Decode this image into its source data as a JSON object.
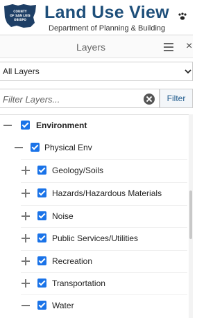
{
  "header": {
    "logo_text": "COUNTY OF SAN LUIS OBISPO",
    "title": "Land Use View",
    "subtitle": "Department of Planning & Building",
    "paw_icon": "paw-icon"
  },
  "panel": {
    "title": "Layers",
    "menu_icon": "list-icon",
    "close_glyph": "×"
  },
  "layer_select": {
    "value": "All Layers",
    "chevron": "chevron-down-icon"
  },
  "filter": {
    "placeholder": "Filter Layers...",
    "button_label": "Filter",
    "clear_icon": "clear-icon"
  },
  "colors": {
    "title_blue": "#1e4f7a",
    "checkbox_blue": "#1a73e8"
  },
  "tree": [
    {
      "label": "Environment",
      "level": 0,
      "expanded": true,
      "checked": true
    },
    {
      "label": "Physical Env",
      "level": 1,
      "expanded": true,
      "checked": true
    },
    {
      "label": "Geology/Soils",
      "level": 2,
      "expanded": false,
      "checked": true
    },
    {
      "label": "Hazards/Hazardous Materials",
      "level": 2,
      "expanded": false,
      "checked": true
    },
    {
      "label": "Noise",
      "level": 2,
      "expanded": false,
      "checked": true
    },
    {
      "label": "Public Services/Utilities",
      "level": 2,
      "expanded": false,
      "checked": true
    },
    {
      "label": "Recreation",
      "level": 2,
      "expanded": false,
      "checked": true
    },
    {
      "label": "Transportation",
      "level": 2,
      "expanded": false,
      "checked": true
    },
    {
      "label": "Water",
      "level": 2,
      "expanded": true,
      "checked": true
    }
  ]
}
